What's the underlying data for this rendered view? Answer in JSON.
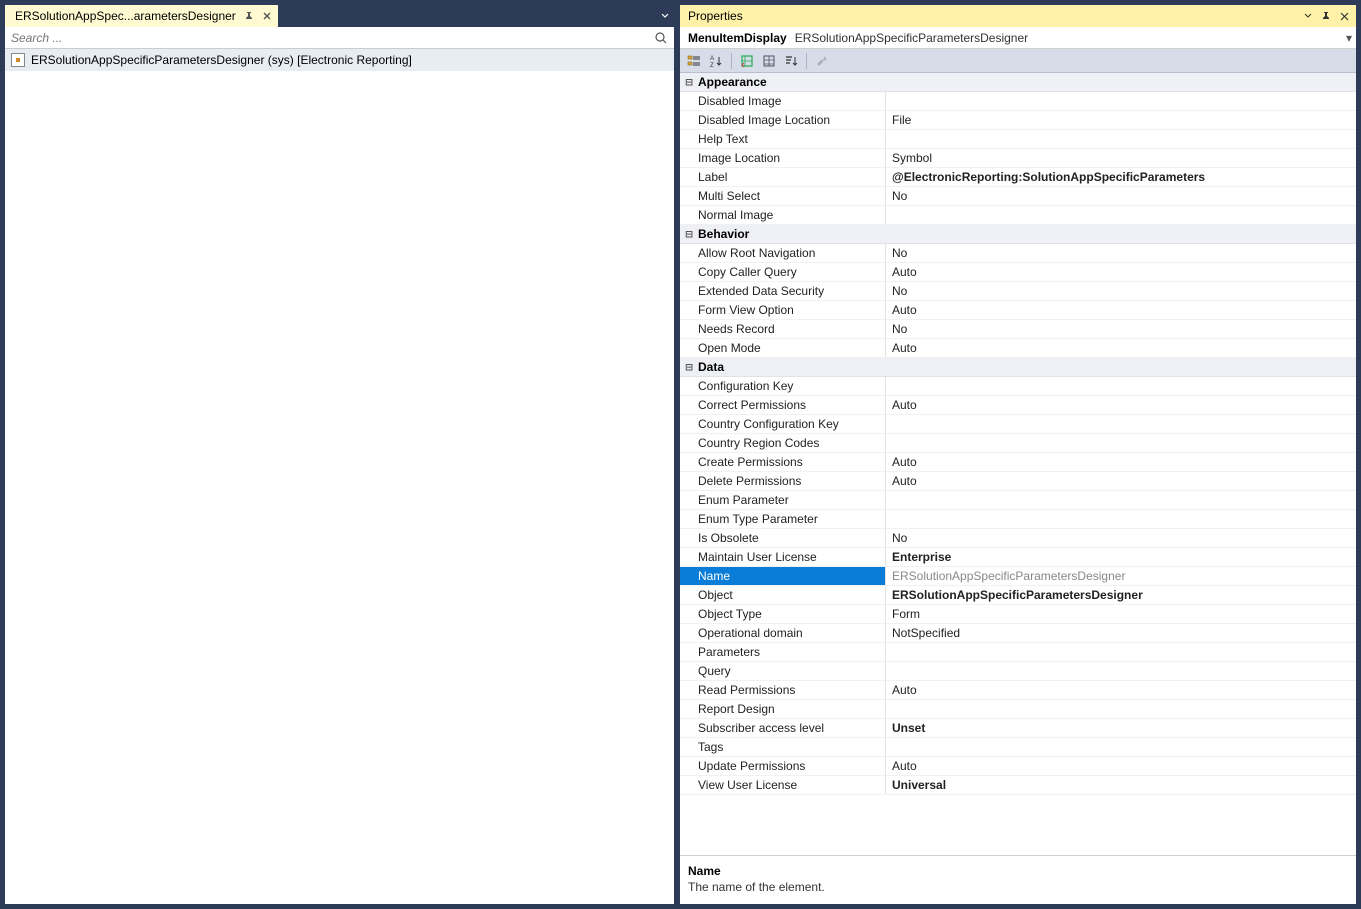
{
  "left": {
    "tab_title": "ERSolutionAppSpec...arametersDesigner",
    "search_placeholder": "Search ...",
    "tree_item": "ERSolutionAppSpecificParametersDesigner (sys) [Electronic Reporting]"
  },
  "props": {
    "title": "Properties",
    "type_label": "MenuItemDisplay",
    "object_name": "ERSolutionAppSpecificParametersDesigner",
    "categories": [
      {
        "name": "Appearance",
        "rows": [
          {
            "n": "Disabled Image",
            "v": ""
          },
          {
            "n": "Disabled Image Location",
            "v": "File"
          },
          {
            "n": "Help Text",
            "v": ""
          },
          {
            "n": "Image Location",
            "v": "Symbol"
          },
          {
            "n": "Label",
            "v": "@ElectronicReporting:SolutionAppSpecificParameters",
            "bold": true
          },
          {
            "n": "Multi Select",
            "v": "No"
          },
          {
            "n": "Normal Image",
            "v": ""
          }
        ]
      },
      {
        "name": "Behavior",
        "rows": [
          {
            "n": "Allow Root Navigation",
            "v": "No"
          },
          {
            "n": "Copy Caller Query",
            "v": "Auto"
          },
          {
            "n": "Extended Data Security",
            "v": "No"
          },
          {
            "n": "Form View Option",
            "v": "Auto"
          },
          {
            "n": "Needs Record",
            "v": "No"
          },
          {
            "n": "Open Mode",
            "v": "Auto"
          }
        ]
      },
      {
        "name": "Data",
        "rows": [
          {
            "n": "Configuration Key",
            "v": ""
          },
          {
            "n": "Correct Permissions",
            "v": "Auto"
          },
          {
            "n": "Country Configuration Key",
            "v": ""
          },
          {
            "n": "Country Region Codes",
            "v": ""
          },
          {
            "n": "Create Permissions",
            "v": "Auto"
          },
          {
            "n": "Delete Permissions",
            "v": "Auto"
          },
          {
            "n": "Enum Parameter",
            "v": ""
          },
          {
            "n": "Enum Type Parameter",
            "v": ""
          },
          {
            "n": "Is Obsolete",
            "v": "No"
          },
          {
            "n": "Maintain User License",
            "v": "Enterprise",
            "bold": true
          },
          {
            "n": "Name",
            "v": "ERSolutionAppSpecificParametersDesigner",
            "selected": true
          },
          {
            "n": "Object",
            "v": "ERSolutionAppSpecificParametersDesigner",
            "bold": true
          },
          {
            "n": "Object Type",
            "v": "Form"
          },
          {
            "n": "Operational domain",
            "v": "NotSpecified"
          },
          {
            "n": "Parameters",
            "v": ""
          },
          {
            "n": "Query",
            "v": ""
          },
          {
            "n": "Read Permissions",
            "v": "Auto"
          },
          {
            "n": "Report Design",
            "v": ""
          },
          {
            "n": "Subscriber access level",
            "v": "Unset",
            "bold": true
          },
          {
            "n": "Tags",
            "v": ""
          },
          {
            "n": "Update Permissions",
            "v": "Auto"
          },
          {
            "n": "View User License",
            "v": "Universal",
            "bold": true
          }
        ]
      }
    ],
    "desc_name": "Name",
    "desc_text": "The name of the element."
  }
}
